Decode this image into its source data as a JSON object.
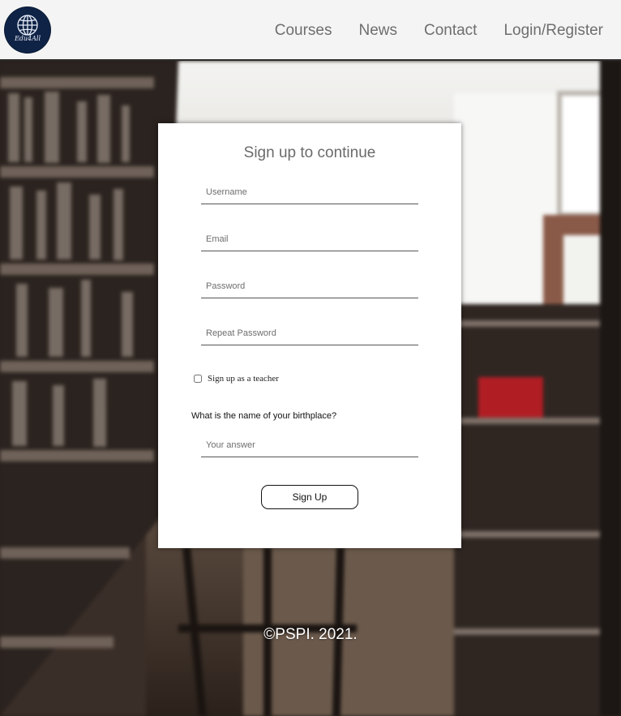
{
  "header": {
    "logo_text": "Edu4All",
    "nav": [
      "Courses",
      "News",
      "Contact",
      "Login/Register"
    ]
  },
  "form": {
    "title": "Sign up to continue",
    "username_placeholder": "Username",
    "email_placeholder": "Email",
    "password_placeholder": "Password",
    "repeat_password_placeholder": "Repeat Password",
    "teacher_checkbox_label": "Sign up as a teacher",
    "teacher_checked": false,
    "security_question": "What is the name of your birthplace?",
    "answer_placeholder": "Your answer",
    "submit_label": "Sign Up"
  },
  "footer": {
    "text": "©PSPI. 2021."
  },
  "colors": {
    "logo_bg": "#0f2347",
    "nav_text": "#6e6e6e",
    "card_bg": "#ffffff",
    "footer_text": "#ffffff"
  },
  "icons": {
    "logo": "globe-icon"
  }
}
